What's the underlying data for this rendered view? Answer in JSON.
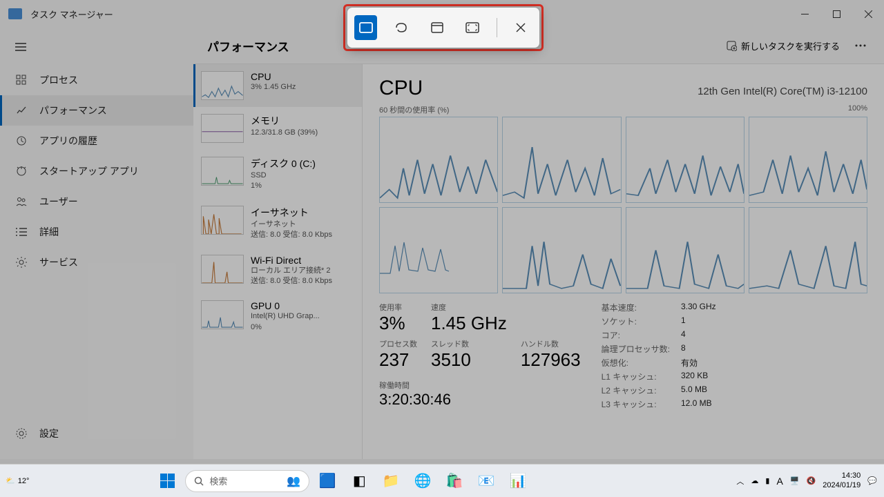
{
  "app": {
    "title": "タスク マネージャー"
  },
  "nav": {
    "items": [
      {
        "label": "プロセス"
      },
      {
        "label": "パフォーマンス"
      },
      {
        "label": "アプリの履歴"
      },
      {
        "label": "スタートアップ アプリ"
      },
      {
        "label": "ユーザー"
      },
      {
        "label": "詳細"
      },
      {
        "label": "サービス"
      }
    ],
    "settings": "設定"
  },
  "header": {
    "title": "パフォーマンス",
    "run_task": "新しいタスクを実行する"
  },
  "perf_list": [
    {
      "name": "CPU",
      "sub1": "3%  1.45 GHz"
    },
    {
      "name": "メモリ",
      "sub1": "12.3/31.8 GB (39%)"
    },
    {
      "name": "ディスク 0 (C:)",
      "sub1": "SSD",
      "sub2": "1%"
    },
    {
      "name": "イーサネット",
      "sub1": "イーサネット",
      "sub2": "送信: 8.0 受信: 8.0 Kbps"
    },
    {
      "name": "Wi-Fi Direct",
      "sub1": "ローカル エリア接続* 2",
      "sub2": "送信: 8.0 受信: 8.0 Kbps"
    },
    {
      "name": "GPU 0",
      "sub1": "Intel(R) UHD Grap...",
      "sub2": "0%"
    }
  ],
  "detail": {
    "title": "CPU",
    "model": "12th Gen Intel(R) Core(TM) i3-12100",
    "chart_caption": "60 秒間の使用率 (%)",
    "chart_max": "100%",
    "stats": {
      "util_label": "使用率",
      "util": "3%",
      "speed_label": "速度",
      "speed": "1.45 GHz",
      "proc_label": "プロセス数",
      "proc": "237",
      "thread_label": "スレッド数",
      "thread": "3510",
      "handle_label": "ハンドル数",
      "handle": "127963",
      "uptime_label": "稼働時間",
      "uptime": "3:20:30:46"
    },
    "right": [
      {
        "lbl": "基本速度:",
        "val": "3.30 GHz"
      },
      {
        "lbl": "ソケット:",
        "val": "1"
      },
      {
        "lbl": "コア:",
        "val": "4"
      },
      {
        "lbl": "論理プロセッサ数:",
        "val": "8"
      },
      {
        "lbl": "仮想化:",
        "val": "有効"
      },
      {
        "lbl": "L1 キャッシュ:",
        "val": "320 KB"
      },
      {
        "lbl": "L2 キャッシュ:",
        "val": "5.0 MB"
      },
      {
        "lbl": "L3 キャッシュ:",
        "val": "12.0 MB"
      }
    ]
  },
  "taskbar": {
    "weather_temp": "12°",
    "search_placeholder": "検索",
    "time": "14:30",
    "date": "2024/01/19"
  }
}
